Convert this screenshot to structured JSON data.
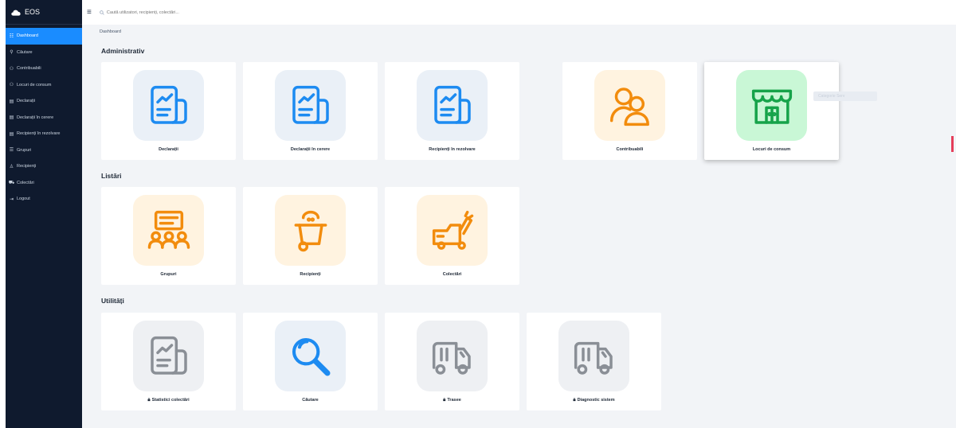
{
  "app": {
    "brand": "EOS"
  },
  "colors": {
    "sidebar_bg": "#0f1a2e",
    "active": "#1a8cff",
    "blue": "#1d8bf1",
    "orange": "#f28c0d",
    "green": "#16a34a",
    "gray": "#8a8f96"
  },
  "sidebar": {
    "items": [
      {
        "label": "Dashboard",
        "icon": "grid-icon",
        "active": true
      },
      {
        "label": "Căutare",
        "icon": "search-icon"
      },
      {
        "label": "Contribuabili",
        "icon": "users-icon"
      },
      {
        "label": "Locuri de consum",
        "icon": "users-icon"
      },
      {
        "label": "Declarații",
        "icon": "document-icon"
      },
      {
        "label": "Declarații în cerere",
        "icon": "document-icon"
      },
      {
        "label": "Recipienți în rezolvare",
        "icon": "document-icon"
      },
      {
        "label": "Grupuri",
        "icon": "list-icon"
      },
      {
        "label": "Recipienți",
        "icon": "bin-icon"
      },
      {
        "label": "Colectări",
        "icon": "truck-icon"
      },
      {
        "label": "Logout",
        "icon": "logout-icon"
      }
    ]
  },
  "topbar": {
    "search_placeholder": "Caută utilizatori, recipienți, colectări..."
  },
  "breadcrumb": "Dashboard",
  "sections": {
    "admin": "Administrativ",
    "lists": "Listări",
    "utils": "Utilități"
  },
  "cards": {
    "declaratii": "Declarații",
    "declaratii_cerere": "Declarații în cerere",
    "recipienti_rezolvare": "Recipienți în rezolvare",
    "contribuabili": "Contribuabili",
    "locuri": "Locuri de consum",
    "grupuri": "Grupuri",
    "recipienti": "Recipienți",
    "colectari": "Colectări",
    "statistici": "Statistici colectări",
    "cautare": "Căutare",
    "trasee": "Trasee",
    "diagnostic": "Diagnostic sistem"
  },
  "ghost": {
    "text": "Categorie Serv"
  }
}
